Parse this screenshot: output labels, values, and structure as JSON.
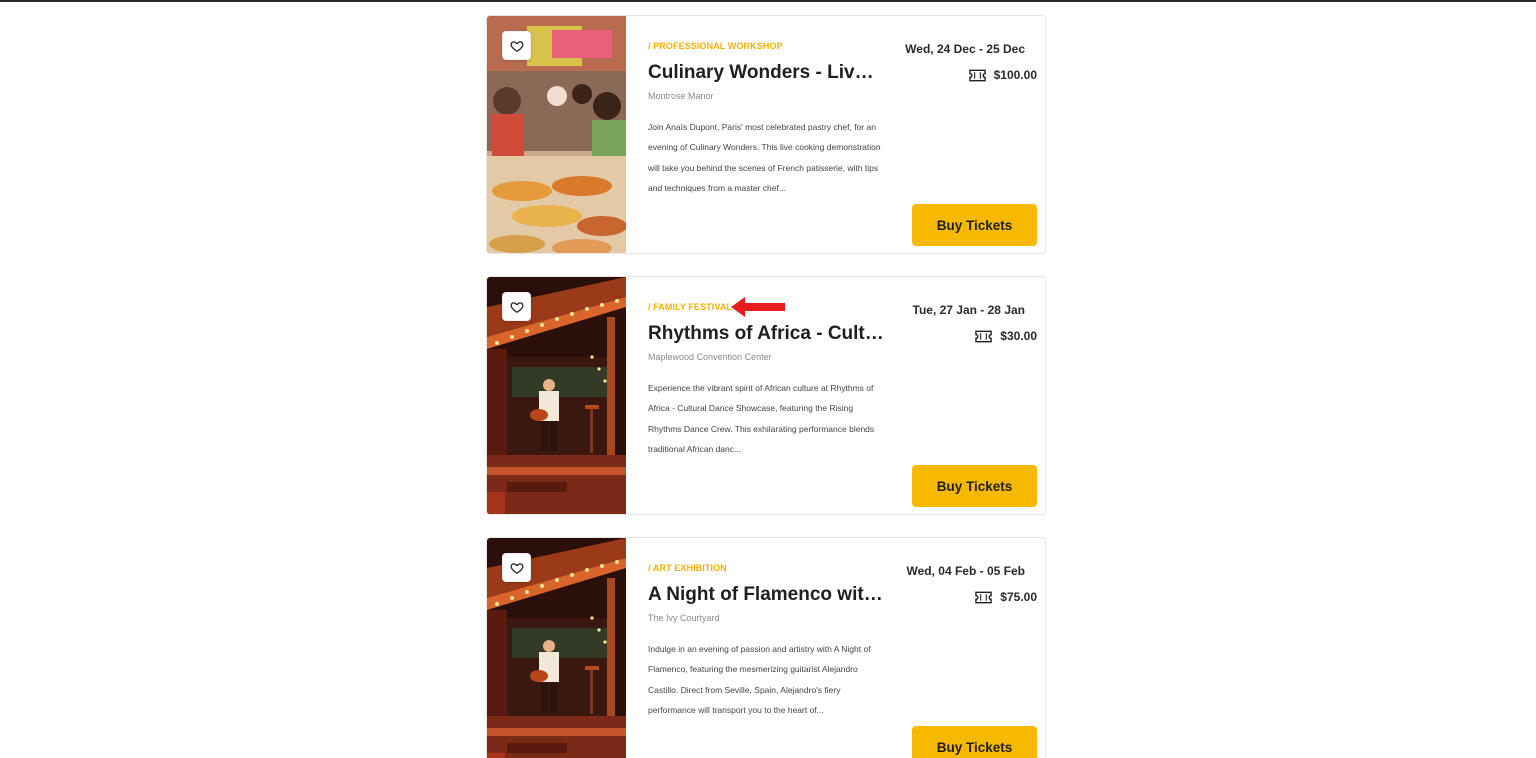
{
  "colors": {
    "accent": "#f7b800",
    "category": "#f2b100",
    "arrow": "#e81c1c"
  },
  "events": [
    {
      "category": "/ PROFESSIONAL WORKSHOP",
      "title": "Culinary Wonders - Live wi...",
      "venue": "Montrose Manor",
      "description": "Join Anaïs Dupont, Paris' most celebrated pastry chef, for an evening of Culinary Wonders. This live cooking demonstration will take you behind the scenes of French patisserie, with tips and techniques from a master chef...",
      "date": "Wed, 24 Dec - 25 Dec",
      "price": "$100.00",
      "buy_label": "Buy Tickets",
      "image": "food-market-photo"
    },
    {
      "category": "/ FAMILY FESTIVAL",
      "title": "Rhythms of Africa - Cultur...",
      "venue": "Maplewood Convention Center",
      "description": "Experience the vibrant spirit of African culture at Rhythms of Africa - Cultural Dance Showcase, featuring the Rising Rhythms Dance Crew. This exhilarating performance blends traditional African danc...",
      "date": "Tue, 27 Jan - 28 Jan",
      "price": "$30.00",
      "buy_label": "Buy Tickets",
      "image": "guitarist-stage-photo"
    },
    {
      "category": "/ ART EXHIBITION",
      "title": "A Night of Flamenco with ...",
      "venue": "The Ivy Courtyard",
      "description": "Indulge in an evening of passion and artistry with A Night of Flamenco, featuring the mesmerizing guitarist Alejandro Castillo. Direct from Seville, Spain, Alejandro's fiery performance will transport you to the heart of...",
      "date": "Wed, 04 Feb - 05 Feb",
      "price": "$75.00",
      "buy_label": "Buy Tickets",
      "image": "guitarist-stage-photo"
    }
  ],
  "icons": {
    "favorite": "heart-icon",
    "ticket": "ticket-icon",
    "annotation": "red-arrow-icon"
  }
}
